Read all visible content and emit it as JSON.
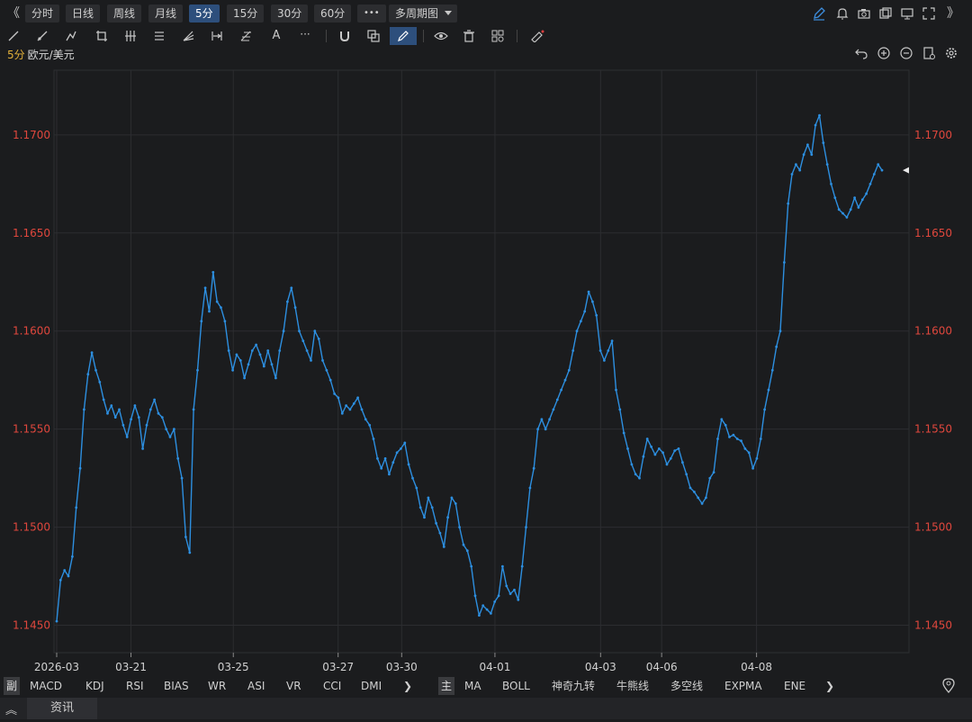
{
  "toolbar": {
    "collapse_left": "《",
    "expand_right": "》",
    "periods": [
      {
        "label": "分时",
        "active": false
      },
      {
        "label": "日线",
        "active": false
      },
      {
        "label": "周线",
        "active": false
      },
      {
        "label": "月线",
        "active": false
      },
      {
        "label": "5分",
        "active": true
      },
      {
        "label": "15分",
        "active": false
      },
      {
        "label": "30分",
        "active": false
      },
      {
        "label": "60分",
        "active": false
      }
    ],
    "more_label": "•••",
    "multi_period_label": "多周期图",
    "right_icons": [
      "edit-icon",
      "bell-icon",
      "camera-icon",
      "copy-icon",
      "screen-icon",
      "fullscreen-icon"
    ]
  },
  "drawing_tools": [
    "line-icon",
    "ray-icon",
    "polyline-icon",
    "crop-icon",
    "parallel-icon",
    "channel-icon",
    "fan-icon",
    "measure-icon",
    "fib-icon",
    "text-icon",
    "more-icon",
    "magnet-icon",
    "layers-icon",
    "pen-icon",
    "eye-icon",
    "trash-icon",
    "group-icon",
    "ruler-icon"
  ],
  "info": {
    "period": "5分",
    "symbol": "欧元/美元"
  },
  "chart_controls": [
    "undo-icon",
    "zoom-in-icon",
    "zoom-out-icon",
    "settings-icon",
    "gear-icon"
  ],
  "chart_data": {
    "type": "line",
    "ylim": [
      1.1436,
      1.1733
    ],
    "y_ticks": [
      "1.1700",
      "1.1650",
      "1.1600",
      "1.1550",
      "1.1500",
      "1.1450"
    ],
    "x_ticks": [
      "2026-03",
      "03-21",
      "03-25",
      "03-27",
      "03-30",
      "04-01",
      "04-03",
      "04-06",
      "04-08"
    ],
    "series": [
      {
        "color": "#2d8fe0",
        "values": [
          1.1452,
          1.1473,
          1.1478,
          1.1475,
          1.1485,
          1.151,
          1.153,
          1.156,
          1.1578,
          1.1589,
          1.158,
          1.1574,
          1.1565,
          1.1558,
          1.1562,
          1.1556,
          1.156,
          1.1552,
          1.1546,
          1.1555,
          1.1562,
          1.1556,
          1.154,
          1.1552,
          1.156,
          1.1565,
          1.1558,
          1.1556,
          1.155,
          1.1546,
          1.155,
          1.1535,
          1.1525,
          1.1495,
          1.1487,
          1.156,
          1.158,
          1.1605,
          1.1622,
          1.161,
          1.163,
          1.1615,
          1.1612,
          1.1605,
          1.159,
          1.158,
          1.1588,
          1.1585,
          1.1576,
          1.1583,
          1.159,
          1.1593,
          1.1588,
          1.1582,
          1.159,
          1.1583,
          1.1576,
          1.159,
          1.16,
          1.1615,
          1.1622,
          1.1612,
          1.16,
          1.1595,
          1.159,
          1.1585,
          1.16,
          1.1596,
          1.1585,
          1.158,
          1.1575,
          1.1568,
          1.1566,
          1.1558,
          1.1562,
          1.156,
          1.1563,
          1.1566,
          1.156,
          1.1555,
          1.1552,
          1.1545,
          1.1535,
          1.153,
          1.1535,
          1.1527,
          1.1533,
          1.1538,
          1.154,
          1.1543,
          1.1532,
          1.1525,
          1.152,
          1.151,
          1.1505,
          1.1515,
          1.151,
          1.1502,
          1.1497,
          1.149,
          1.1505,
          1.1515,
          1.1512,
          1.15,
          1.1491,
          1.1488,
          1.148,
          1.1465,
          1.1455,
          1.146,
          1.1458,
          1.1456,
          1.1462,
          1.1465,
          1.148,
          1.147,
          1.1466,
          1.1468,
          1.1463,
          1.148,
          1.15,
          1.152,
          1.153,
          1.155,
          1.1555,
          1.155,
          1.1555,
          1.156,
          1.1565,
          1.157,
          1.1575,
          1.158,
          1.159,
          1.16,
          1.1605,
          1.161,
          1.162,
          1.1615,
          1.1608,
          1.159,
          1.1585,
          1.159,
          1.1595,
          1.157,
          1.156,
          1.1548,
          1.154,
          1.1532,
          1.1527,
          1.1525,
          1.1536,
          1.1545,
          1.1541,
          1.1537,
          1.154,
          1.1538,
          1.1532,
          1.1535,
          1.1539,
          1.154,
          1.1533,
          1.1527,
          1.152,
          1.1518,
          1.1515,
          1.1512,
          1.1515,
          1.1525,
          1.1528,
          1.1545,
          1.1555,
          1.1552,
          1.1546,
          1.1547,
          1.1545,
          1.1544,
          1.154,
          1.1538,
          1.153,
          1.1535,
          1.1545,
          1.156,
          1.157,
          1.158,
          1.1592,
          1.16,
          1.1635,
          1.1665,
          1.168,
          1.1685,
          1.1682,
          1.169,
          1.1695,
          1.169,
          1.1705,
          1.171,
          1.1696,
          1.1685,
          1.1675,
          1.1668,
          1.1662,
          1.166,
          1.1658,
          1.1662,
          1.1668,
          1.1663,
          1.1667,
          1.167,
          1.1675,
          1.168,
          1.1685,
          1.1682
        ]
      }
    ],
    "last_value": 1.1682,
    "grid": true
  },
  "bottom": {
    "sub_tag": "副",
    "sub_indicators": [
      "MACD",
      "KDJ",
      "RSI",
      "BIAS",
      "WR",
      "ASI",
      "VR",
      "CCI",
      "DMI"
    ],
    "main_tag": "主",
    "main_indicators": [
      "MA",
      "BOLL",
      "神奇九转",
      "牛熊线",
      "多空线",
      "EXPMA",
      "ENE"
    ],
    "arrow": "❯"
  },
  "news": {
    "expand_icon": "︽",
    "label": "资讯"
  }
}
